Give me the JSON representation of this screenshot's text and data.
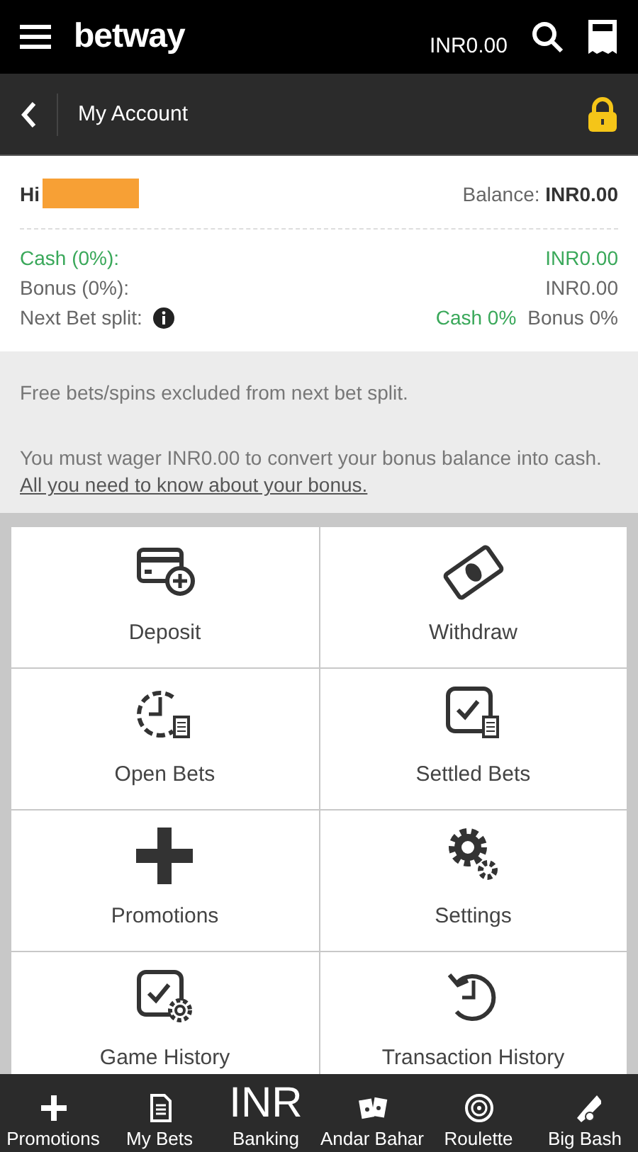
{
  "header": {
    "logo": "betway",
    "balance": "INR0.00"
  },
  "subheader": {
    "title": "My Account"
  },
  "account": {
    "greeting": "Hi",
    "name_redacted": true,
    "balance_label": "Balance:",
    "balance_value": "INR0.00",
    "rows": [
      {
        "label": "Cash (0%):",
        "value": "INR0.00",
        "kind": "cash"
      },
      {
        "label": "Bonus (0%):",
        "value": "INR0.00",
        "kind": "bonus"
      }
    ],
    "split": {
      "label": "Next Bet split:",
      "cash": "Cash 0%",
      "bonus": "Bonus 0%"
    }
  },
  "info": {
    "note": "Free bets/spins excluded from next bet split.",
    "wager": "You must wager INR0.00 to convert your bonus balance into cash.",
    "link": "All you need to know about your bonus."
  },
  "tiles": [
    {
      "label": "Deposit"
    },
    {
      "label": "Withdraw"
    },
    {
      "label": "Open Bets"
    },
    {
      "label": "Settled Bets"
    },
    {
      "label": "Promotions"
    },
    {
      "label": "Settings"
    },
    {
      "label": "Game History"
    },
    {
      "label": "Transaction History"
    }
  ],
  "bottom_nav": [
    {
      "label": "Promotions",
      "kind": "icon"
    },
    {
      "label": "My Bets",
      "kind": "icon"
    },
    {
      "label": "Banking",
      "kind": "text",
      "icon_text": "INR"
    },
    {
      "label": "Andar Bahar",
      "kind": "icon"
    },
    {
      "label": "Roulette",
      "kind": "icon"
    },
    {
      "label": "Big Bash",
      "kind": "icon"
    }
  ]
}
